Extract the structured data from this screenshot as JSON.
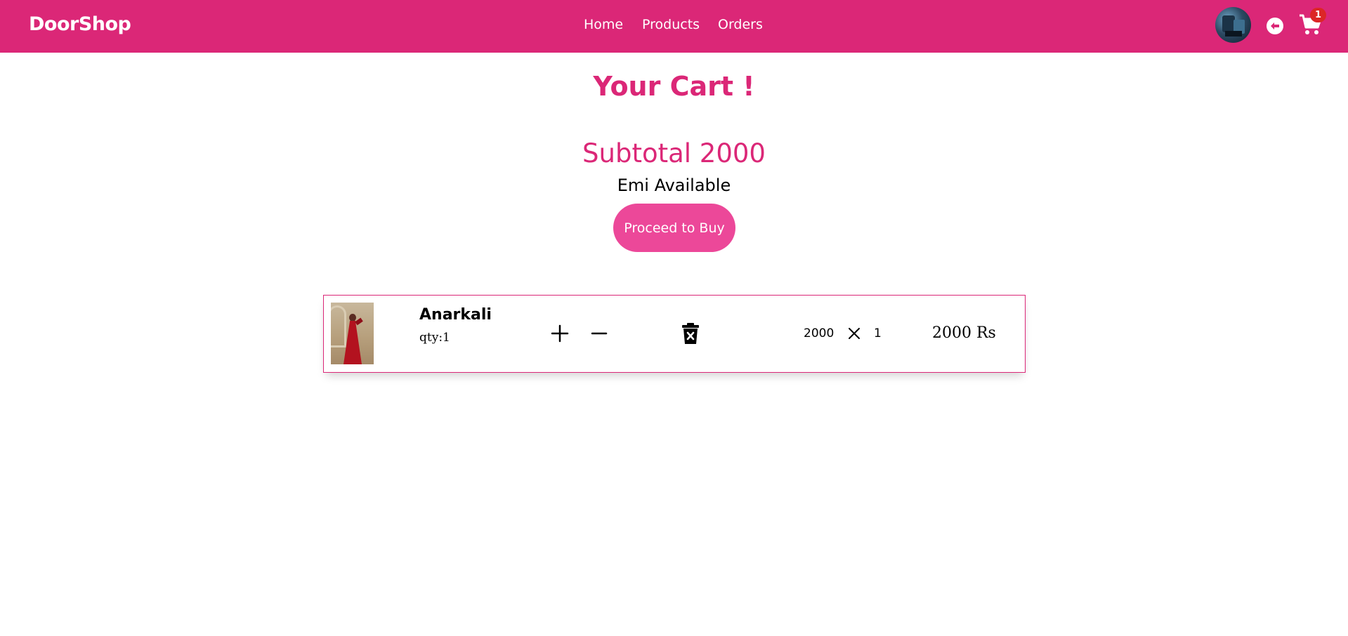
{
  "app": {
    "brand": "DoorShop",
    "theme_color": "#db2777",
    "accent_color": "#ec4899",
    "badge_color": "#dc2626"
  },
  "nav": {
    "links": [
      {
        "label": "Home"
      },
      {
        "label": "Products"
      },
      {
        "label": "Orders"
      }
    ],
    "icons": [
      "user-avatar",
      "logout-icon",
      "cart-icon"
    ],
    "cart_count": "1"
  },
  "cart": {
    "title": "Your Cart !",
    "subtotal_label": "Subtotal 2000",
    "emi_label": "Emi Available",
    "proceed_label": "Proceed to Buy",
    "items": [
      {
        "name": "Anarkali",
        "qty_label": "qty:1",
        "unit_price": "2000",
        "quantity": "1",
        "total_label": "2000 Rs"
      }
    ]
  }
}
